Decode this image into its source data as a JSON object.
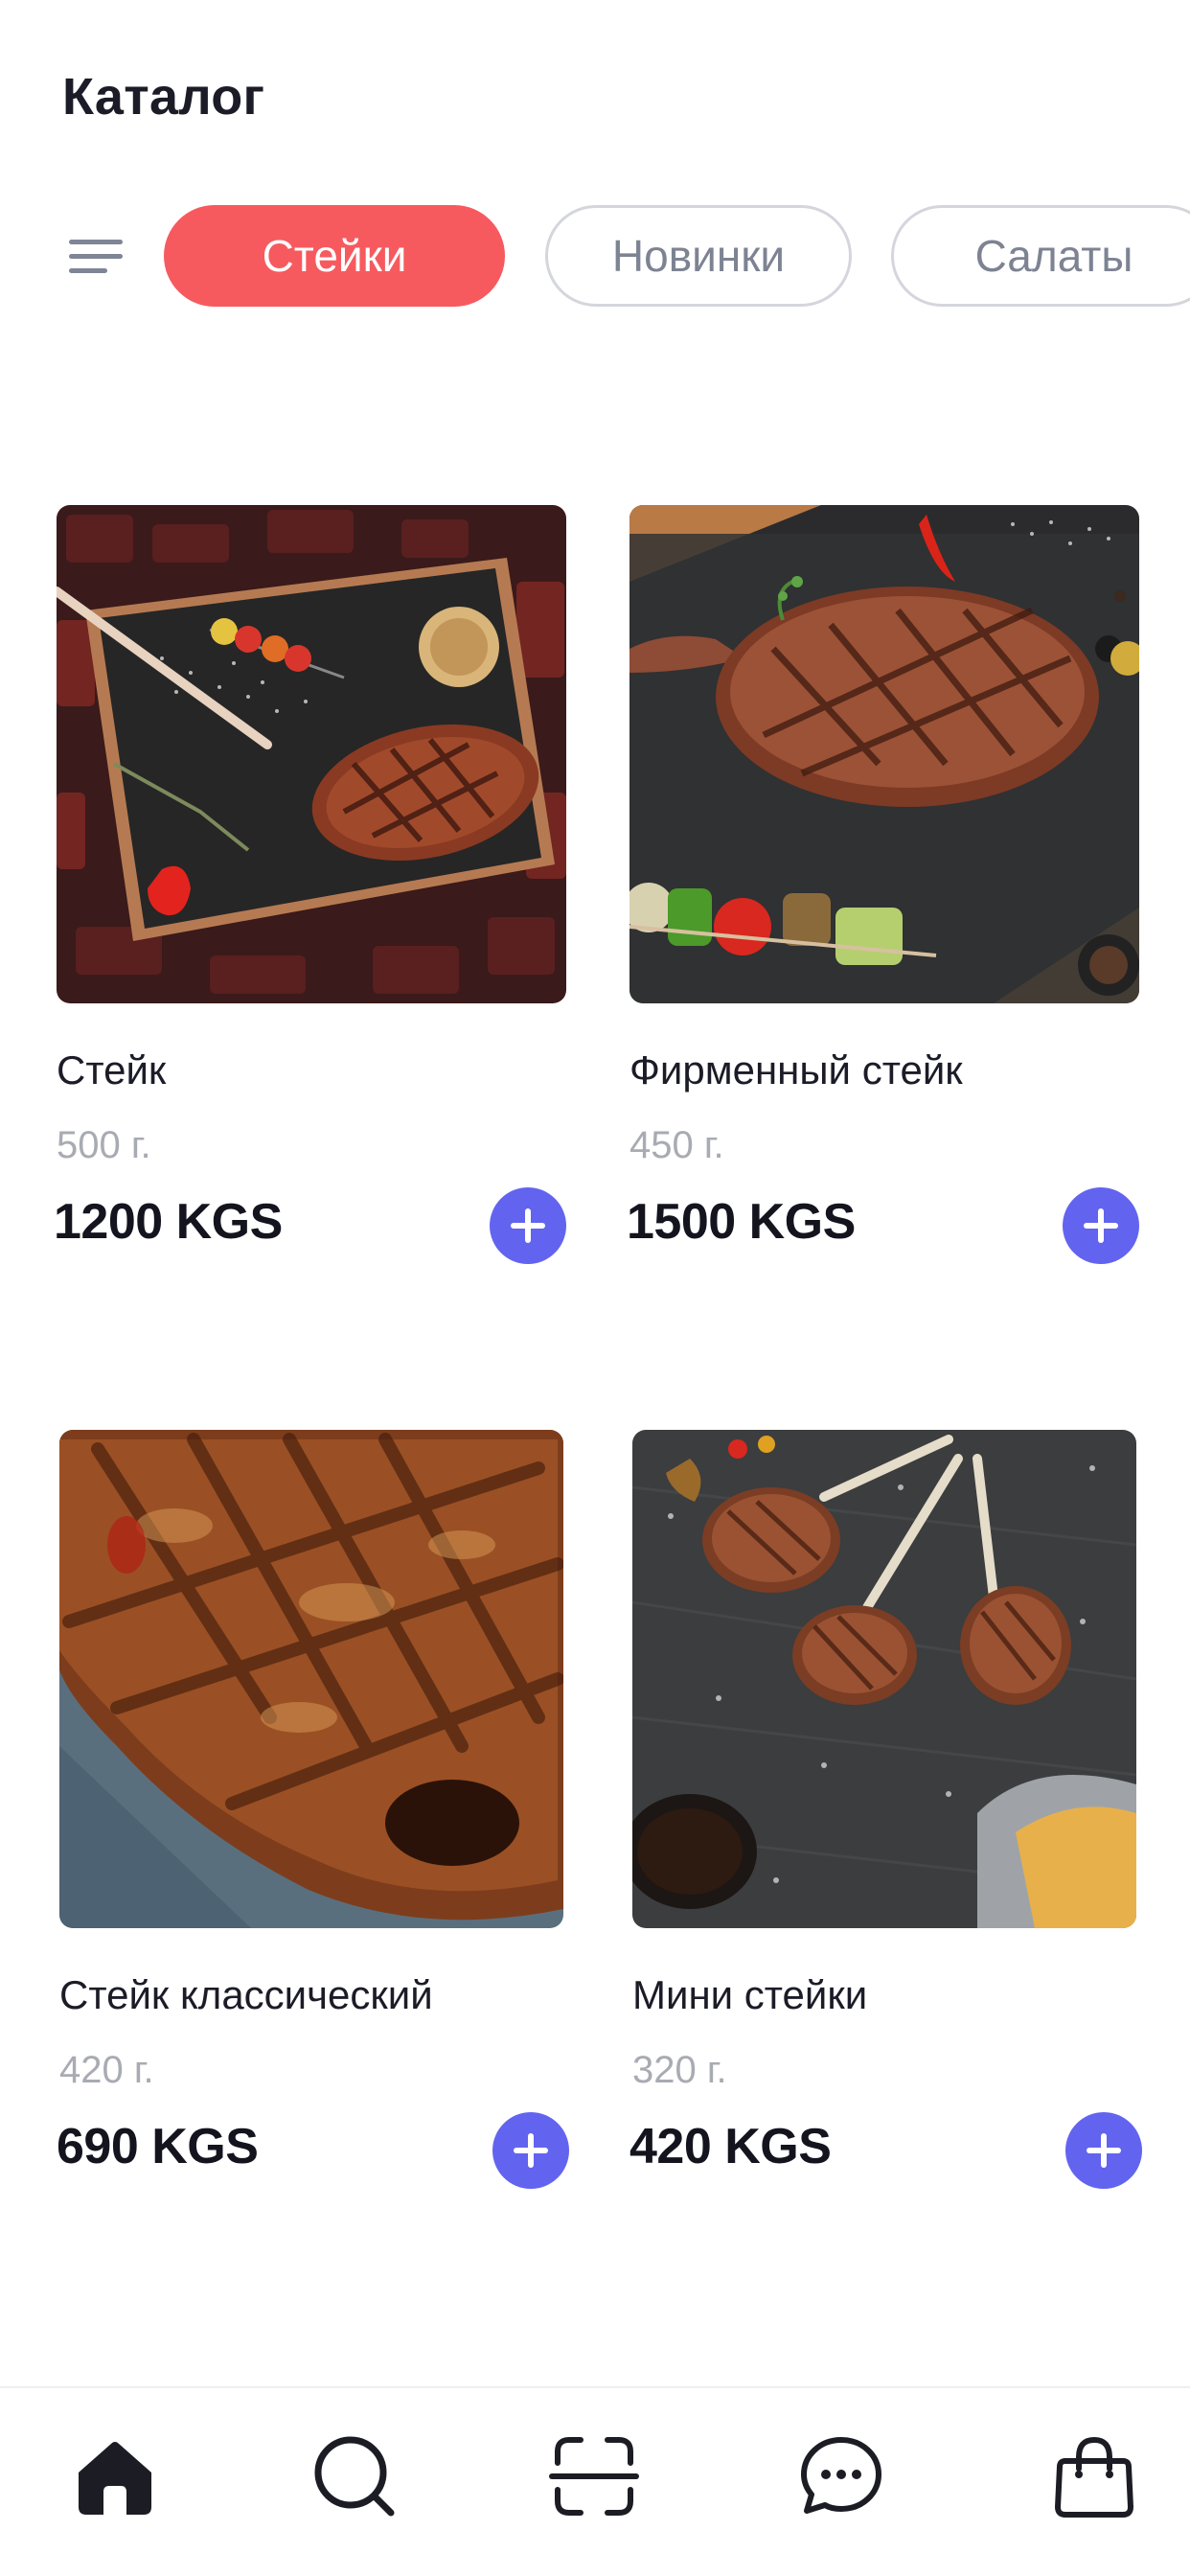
{
  "header": {
    "title": "Каталог"
  },
  "filters": {
    "menu_icon": "filter-menu-icon",
    "chips": [
      {
        "label": "Стейки",
        "active": true
      },
      {
        "label": "Новинки",
        "active": false
      },
      {
        "label": "Салаты",
        "active": false
      }
    ]
  },
  "products": [
    {
      "name": "Стейк",
      "weight": "500 г.",
      "price": "1200 KGS",
      "image": "tomahawk-steak-photo"
    },
    {
      "name": "Фирменный стейк",
      "weight": "450 г.",
      "price": "1500 KGS",
      "image": "signature-steak-photo"
    },
    {
      "name": "Стейк классический",
      "weight": "420 г.",
      "price": "690 KGS",
      "image": "classic-steak-photo"
    },
    {
      "name": "Мини стейки",
      "weight": "320 г.",
      "price": "420 KGS",
      "image": "mini-steaks-photo"
    }
  ],
  "bottom_nav": [
    {
      "icon": "home-icon",
      "active": true
    },
    {
      "icon": "search-icon",
      "active": false
    },
    {
      "icon": "scan-icon",
      "active": false
    },
    {
      "icon": "chat-icon",
      "active": false
    },
    {
      "icon": "shopping-bag-icon",
      "active": false
    }
  ],
  "colors": {
    "accent_red": "#f65a5f",
    "add_button": "#6264ef",
    "text_primary": "#1c1c28",
    "text_muted": "#a9abb3",
    "chip_outline": "#d4d6dc"
  }
}
